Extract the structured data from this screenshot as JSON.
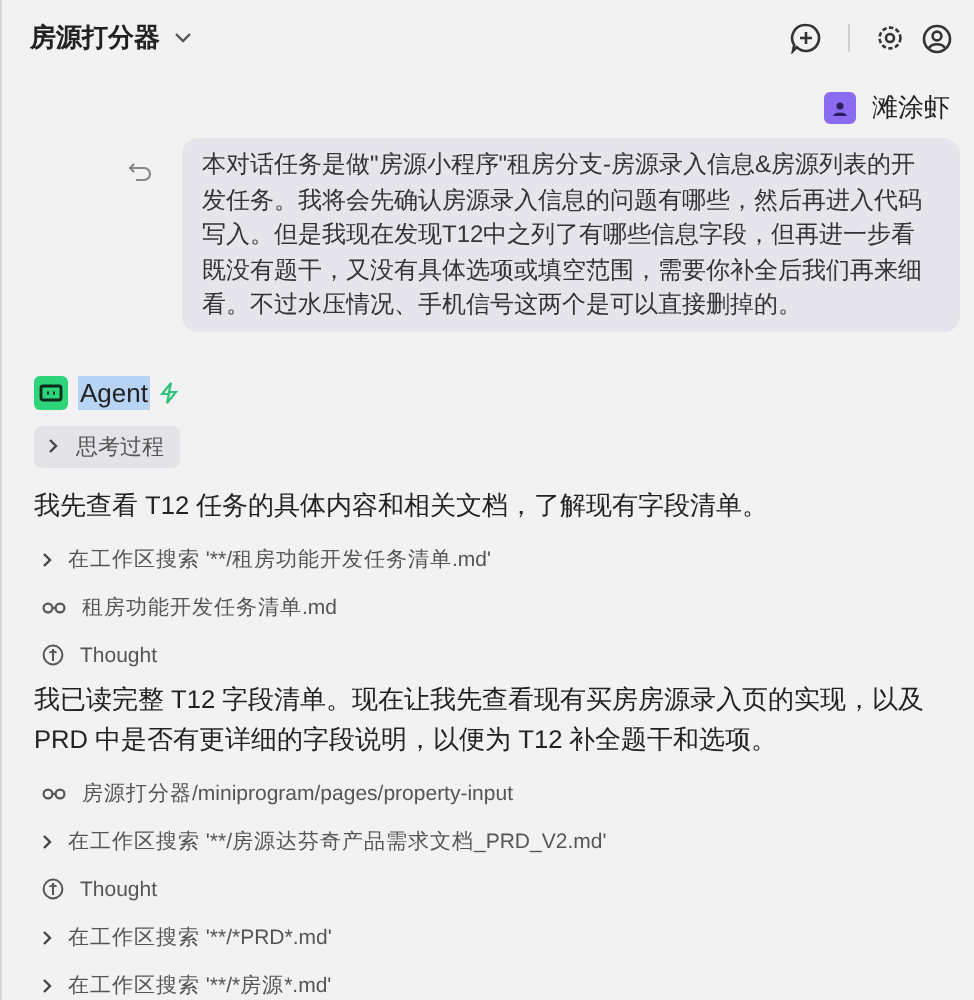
{
  "header": {
    "title": "房源打分器"
  },
  "user_message": {
    "name": "滩涂虾",
    "text": "本对话任务是做\"房源小程序\"租房分支-房源录入信息&房源列表的开发任务。我将会先确认房源录入信息的问题有哪些，然后再进入代码写入。但是我现在发现T12中之列了有哪些信息字段，但再进一步看既没有题干，又没有具体选项或填空范围，需要你补全后我们再来细看。不过水压情况、手机信号这两个是可以直接删掉的。"
  },
  "agent": {
    "name": "Agent",
    "name_highlighted": true,
    "items": [
      {
        "kind": "thinking",
        "text": "思考过程"
      },
      {
        "kind": "text",
        "text": "我先查看 T12 任务的具体内容和相关文档，了解现有字段清单。"
      },
      {
        "kind": "search",
        "text": "在工作区搜索 '**/租房功能开发任务清单.md'"
      },
      {
        "kind": "read",
        "text": "租房功能开发任务清单.md"
      },
      {
        "kind": "thought",
        "text": "Thought"
      },
      {
        "kind": "text",
        "text": "我已读完整 T12 字段清单。现在让我先查看现有买房房源录入页的实现，以及 PRD 中是否有更详细的字段说明，以便为 T12 补全题干和选项。"
      },
      {
        "kind": "read",
        "text": "房源打分器/miniprogram/pages/property-input"
      },
      {
        "kind": "search",
        "text": "在工作区搜索 '**/房源达芬奇产品需求文档_PRD_V2.md'"
      },
      {
        "kind": "thought",
        "text": "Thought"
      },
      {
        "kind": "search",
        "text": "在工作区搜索 '**/*PRD*.md'"
      },
      {
        "kind": "search",
        "text": "在工作区搜索 '**/*房源*.md'"
      }
    ]
  }
}
